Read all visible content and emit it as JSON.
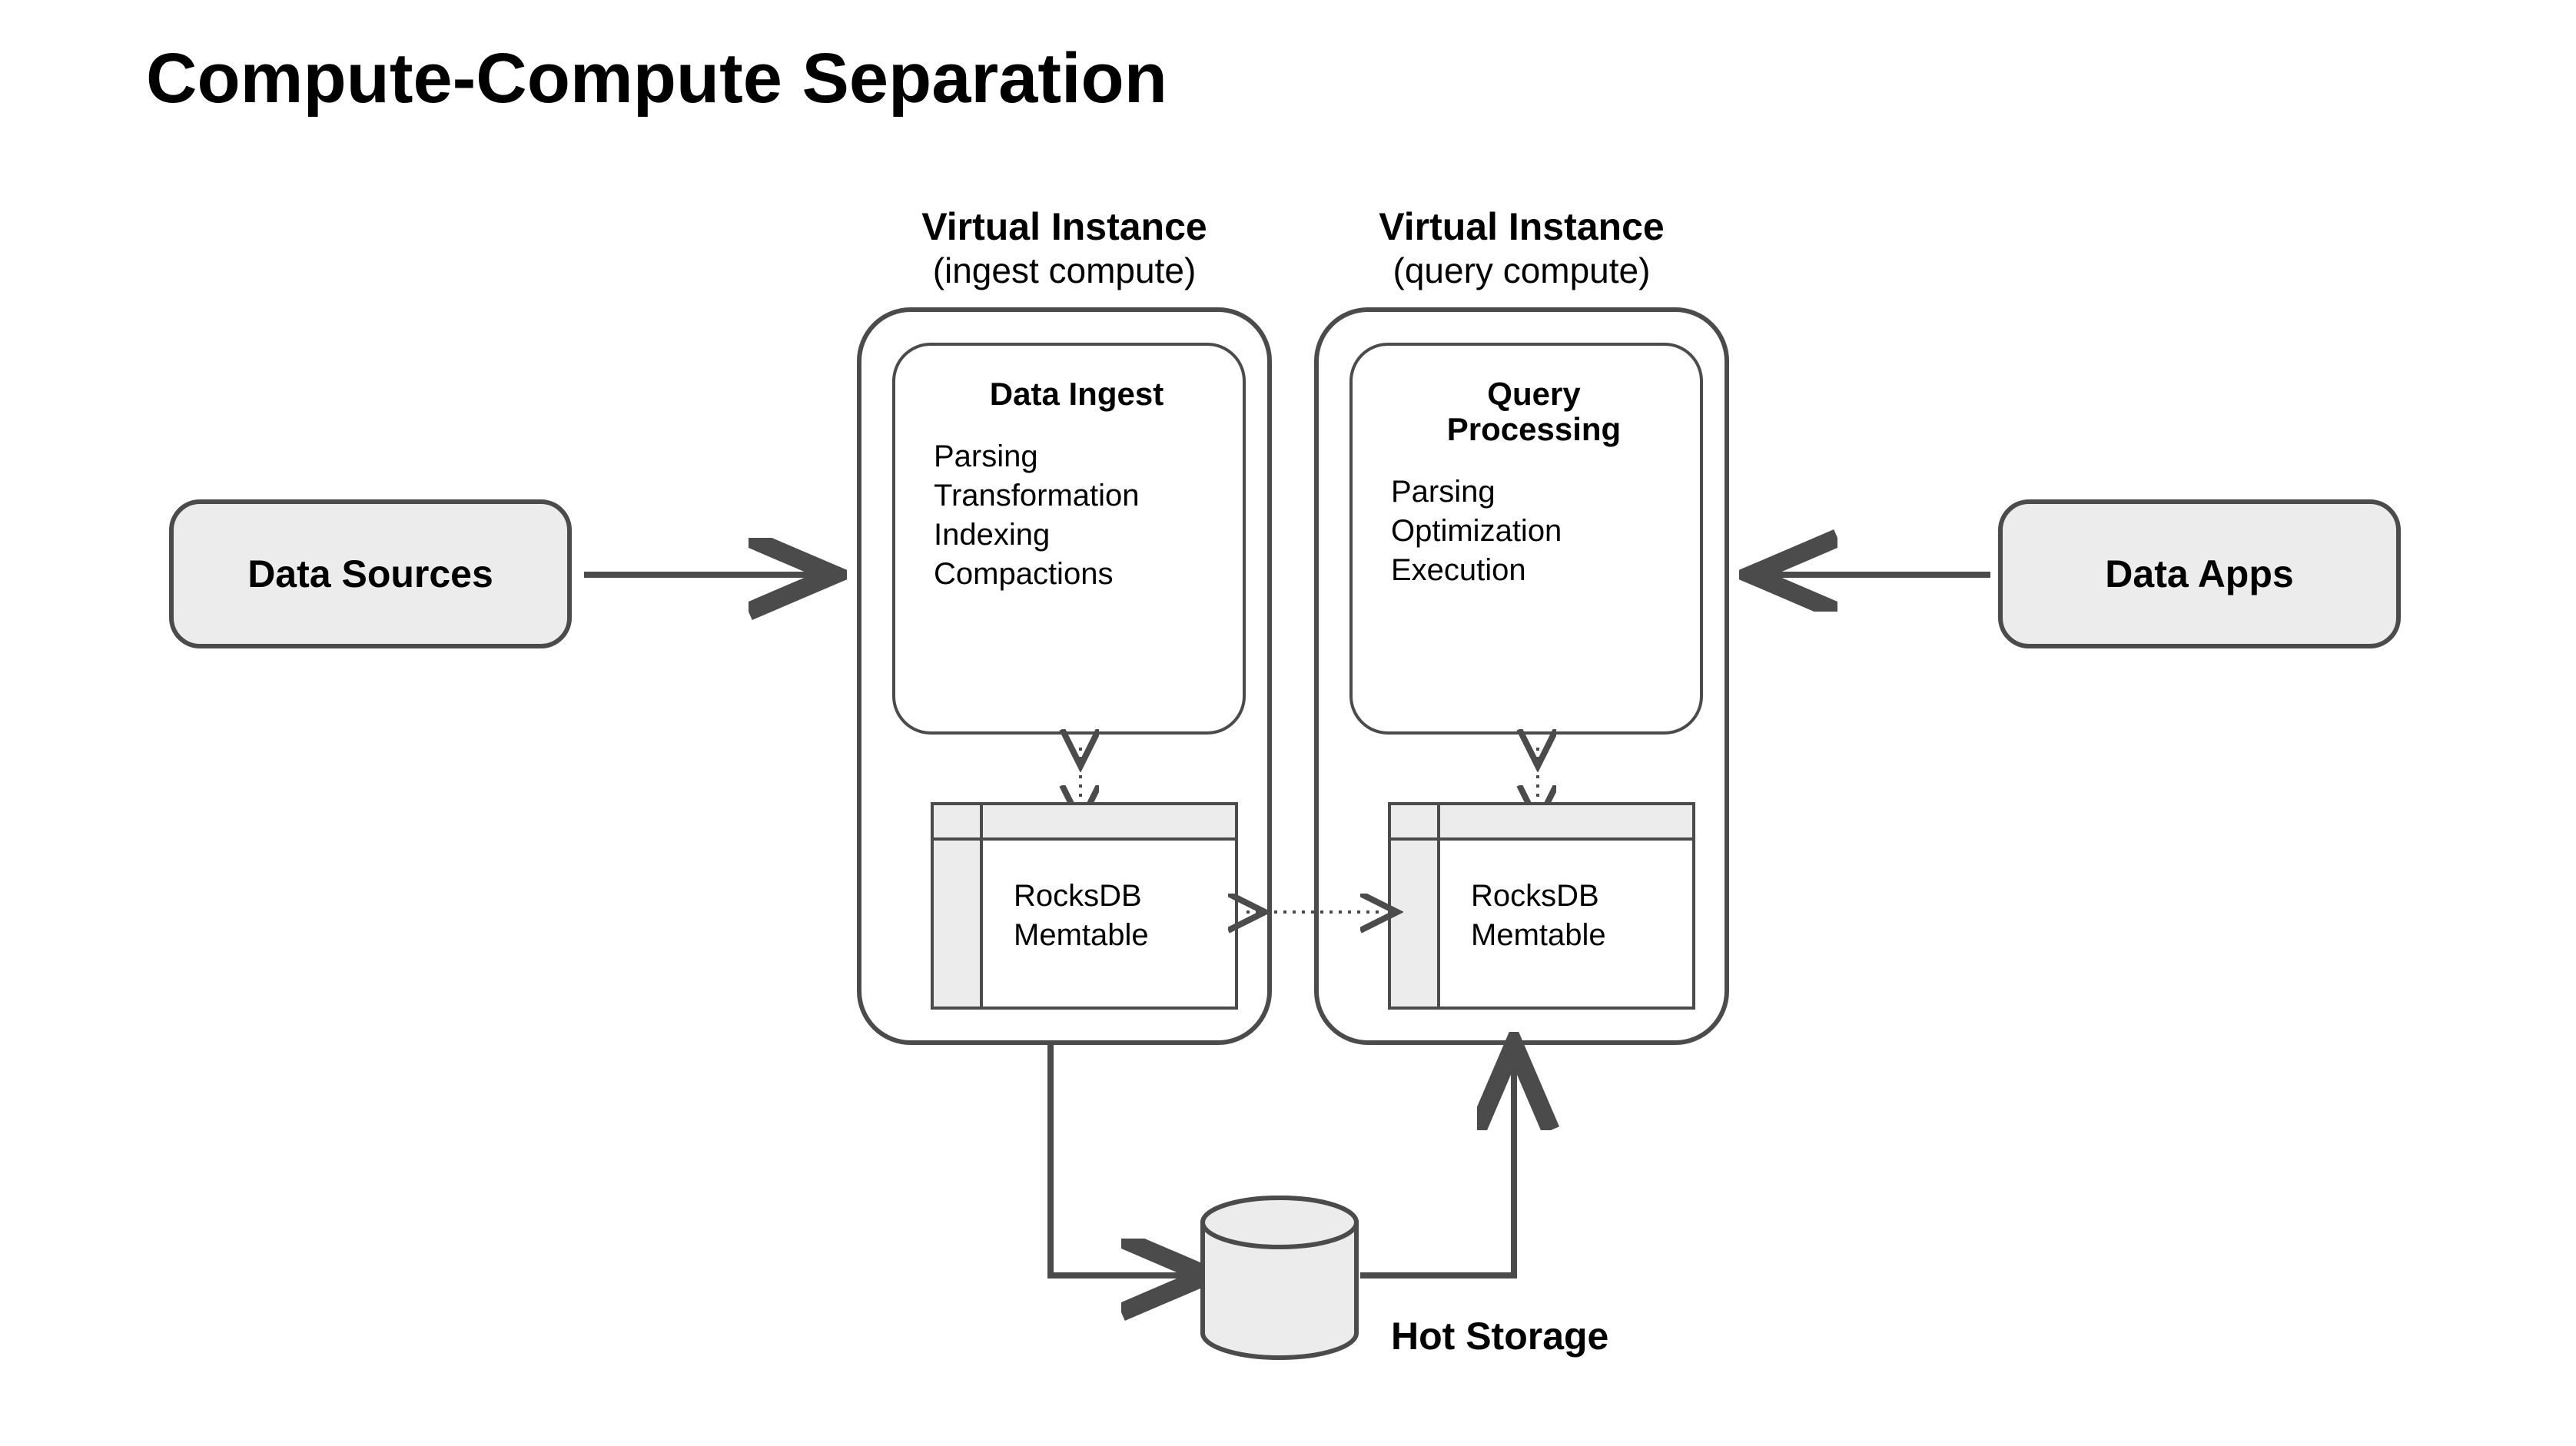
{
  "title": "Compute-Compute Separation",
  "sources": {
    "label": "Data Sources"
  },
  "apps": {
    "label": "Data Apps"
  },
  "instance_left": {
    "header_title": "Virtual Instance",
    "header_sub": "(ingest compute)",
    "task_title": "Data Ingest",
    "task_items": [
      "Parsing",
      "Transformation",
      "Indexing",
      "Compactions"
    ],
    "rocks": {
      "line1": "RocksDB",
      "line2": "Memtable"
    }
  },
  "instance_right": {
    "header_title": "Virtual Instance",
    "header_sub": "(query compute)",
    "task_title": "Query Processing",
    "task_items": [
      "Parsing",
      "Optimization",
      "Execution"
    ],
    "rocks": {
      "line1": "RocksDB",
      "line2": "Memtable"
    }
  },
  "hot_storage": {
    "label": "Hot Storage"
  }
}
